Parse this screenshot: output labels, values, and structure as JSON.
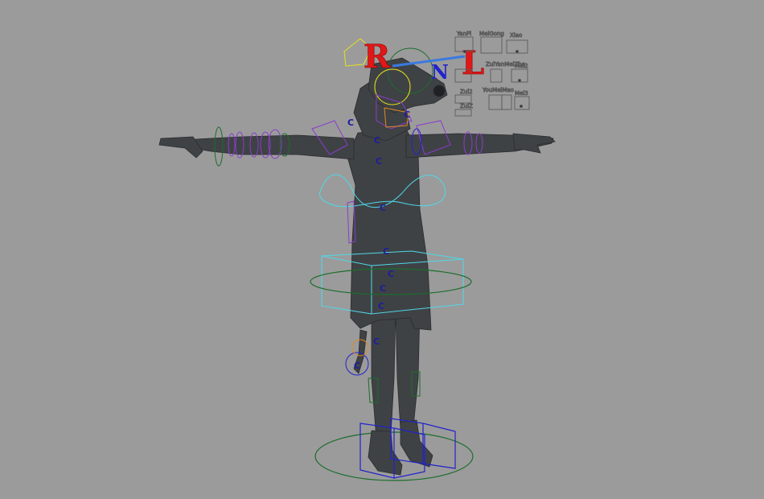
{
  "viewport": {
    "background": "#9b9b9b",
    "mesh_color": "#3f4245",
    "control_colors": {
      "cyan": "#4fd8e8",
      "green": "#1b6e2c",
      "blue": "#2222cc",
      "purple": "#8a3ccc",
      "yellow": "#e8e21a",
      "red": "#e01818",
      "orange": "#e08a20"
    }
  },
  "head_letters": {
    "r": "R",
    "n": "N",
    "l": "L"
  },
  "spine_control_letter": "C",
  "face_panel": {
    "labels": {
      "yanpi": "YanPi",
      "meigong": "MeiGong",
      "xiao": "Xiao",
      "zuiyan": "ZuiYanMeiZhe",
      "mei2": "Mei2",
      "zui2": "Zui2",
      "youmei": "YouMeiMao",
      "mei3": "Mei3",
      "zuiz": "ZuiZ"
    }
  }
}
